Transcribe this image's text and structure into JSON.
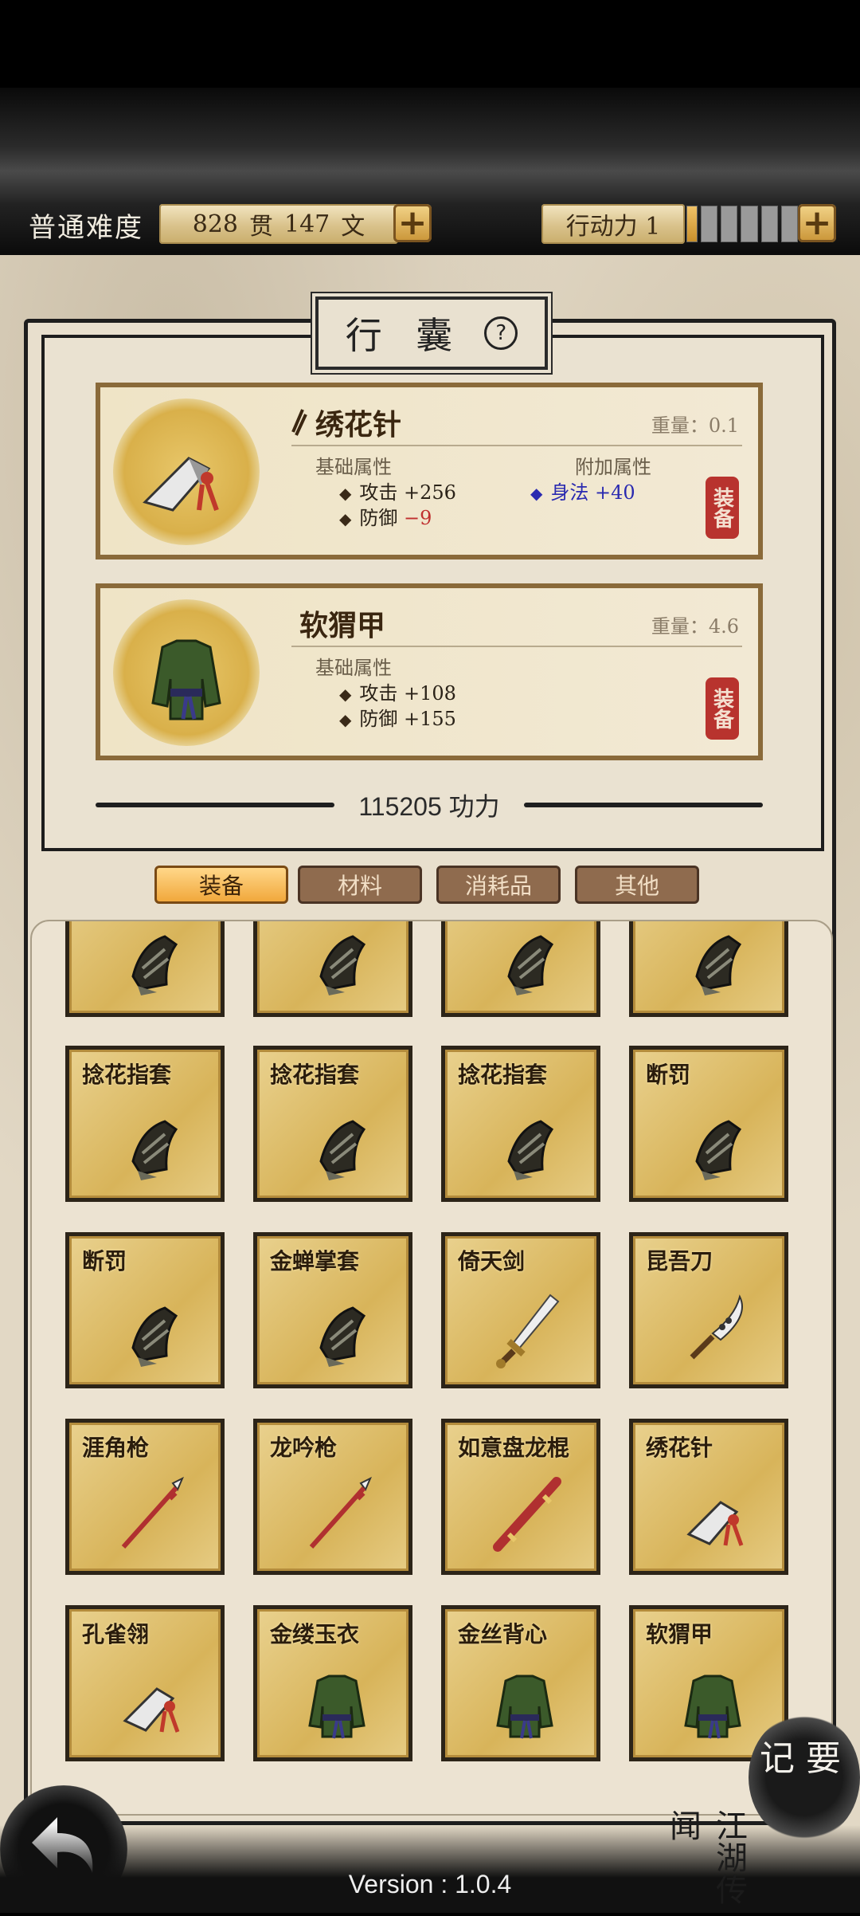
{
  "topbar": {
    "difficulty": "普通难度",
    "money_guan": "828",
    "guan_unit": "贯",
    "money_wen": "147",
    "wen_unit": "文",
    "action_label": "行动力 1",
    "action_level": 1,
    "action_max": 6
  },
  "panel": {
    "title": "行 囊",
    "help": "?"
  },
  "equipped": [
    {
      "name": "绣花针",
      "weight": "重量：0.1",
      "base_label": "基础属性",
      "extra_label": "附加属性",
      "stats": [
        {
          "text": "攻击 +256"
        },
        {
          "label": "防御",
          "value": "−9"
        }
      ],
      "bonus": "身法 +40",
      "equip_btn": "装备",
      "icon": "dart-icon"
    },
    {
      "name": "软猬甲",
      "weight": "重量：4.6",
      "base_label": "基础属性",
      "stats": [
        {
          "text": "攻击 +108"
        },
        {
          "text": "防御 +155"
        }
      ],
      "equip_btn": "装备",
      "icon": "armor-icon"
    }
  ],
  "power": {
    "value": "115205",
    "unit": "功力"
  },
  "tabs": [
    "装备",
    "材料",
    "消耗品",
    "其他"
  ],
  "inventory": [
    {
      "name": "",
      "icon": "gauntlet-icon"
    },
    {
      "name": "",
      "icon": "gauntlet-icon"
    },
    {
      "name": "",
      "icon": "gauntlet-icon"
    },
    {
      "name": "",
      "icon": "gauntlet-icon"
    },
    {
      "name": "捻花指套",
      "icon": "gauntlet-icon"
    },
    {
      "name": "捻花指套",
      "icon": "gauntlet-icon"
    },
    {
      "name": "捻花指套",
      "icon": "gauntlet-icon"
    },
    {
      "name": "断罚",
      "icon": "gauntlet-icon"
    },
    {
      "name": "断罚",
      "icon": "gauntlet-icon"
    },
    {
      "name": "金蝉掌套",
      "icon": "gauntlet-icon"
    },
    {
      "name": "倚天剑",
      "icon": "sword-icon"
    },
    {
      "name": "昆吾刀",
      "icon": "saber-icon"
    },
    {
      "name": "涯角枪",
      "icon": "spear-icon"
    },
    {
      "name": "龙吟枪",
      "icon": "spear-icon"
    },
    {
      "name": "如意盘龙棍",
      "icon": "staff-icon"
    },
    {
      "name": "绣花针",
      "icon": "dart-icon"
    },
    {
      "name": "孔雀翎",
      "icon": "dart-icon"
    },
    {
      "name": "金缕玉衣",
      "icon": "armor-icon"
    },
    {
      "name": "金丝背心",
      "icon": "armor-icon"
    },
    {
      "name": "软猬甲",
      "icon": "armor-icon"
    }
  ],
  "corner": {
    "record": "记 要",
    "jianghu": "江湖传闻"
  },
  "version": "Version : 1.0.4"
}
